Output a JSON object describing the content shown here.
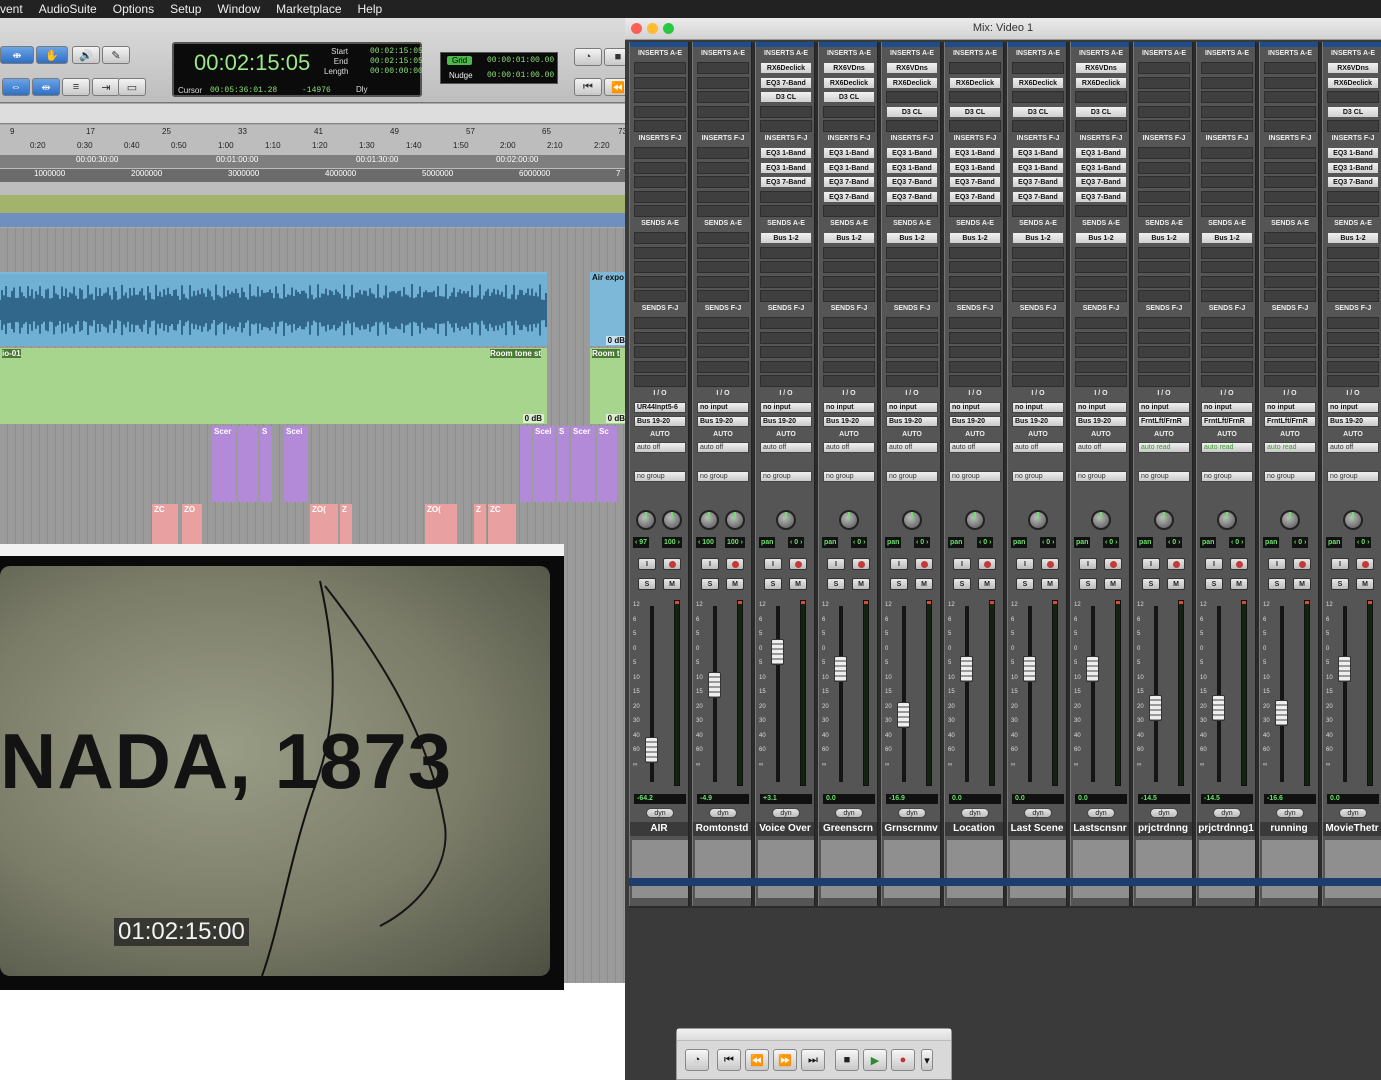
{
  "menubar": {
    "items": [
      "vent",
      "AudioSuite",
      "Options",
      "Setup",
      "Window",
      "Marketplace",
      "Help"
    ]
  },
  "edit": {
    "counter": {
      "main": "00:02:15:05",
      "start_label": "Start",
      "start": "00:02:15:05",
      "end_label": "End",
      "end": "00:02:15:05",
      "length_label": "Length",
      "length": "00:00:00:00",
      "cursor_label": "Cursor",
      "cursor": "00:05:36:01.28",
      "cursor_sample": "-14976",
      "dly_label": "Dly"
    },
    "grid": {
      "grid_label": "Grid",
      "grid_value": "00:00:01:00.00",
      "nudge_label": "Nudge",
      "nudge_value": "00:00:01:00.00"
    },
    "ruler_bars": [
      "9",
      "17",
      "25",
      "33",
      "41",
      "49",
      "57",
      "65",
      "73"
    ],
    "ruler_minsec": [
      "0:20",
      "0:30",
      "0:40",
      "0:50",
      "1:00",
      "1:10",
      "1:20",
      "1:30",
      "1:40",
      "1:50",
      "2:00",
      "2:10",
      "2:20"
    ],
    "ruler_timecode": [
      "00:00:30:00",
      "00:01:00:00",
      "00:01:30:00",
      "00:02:00:00"
    ],
    "ruler_samples": [
      "1000000",
      "2000000",
      "3000000",
      "4000000",
      "5000000",
      "6000000",
      "7"
    ],
    "clips": {
      "air_exp": "Air expo",
      "air_db": "0 dB",
      "io01": "io-01",
      "room_tone_1": "Room tone st",
      "room_tone_2": "Room t",
      "room_db_1": "0 dB",
      "room_db_2": "0 dB",
      "scene_a": "Scer",
      "scene_b": "S",
      "scene_c": "Scei",
      "scene_d": "Scei",
      "scene_e": "S",
      "scene_f": "Scer",
      "scene_g": "Sc",
      "zo_a": "ZC",
      "zo_b": "ZO",
      "zo_c": "ZO(",
      "zo_d": "Z",
      "zo_e": "ZO(",
      "zo_f": "Z",
      "zo_g": "ZC"
    }
  },
  "video": {
    "title_card": "NADA, 1873",
    "timecode": "01:02:15:00"
  },
  "mix": {
    "window_title": "Mix: Video 1",
    "labels": {
      "inserts_ae": "INSERTS A-E",
      "inserts_fj": "INSERTS F-J",
      "sends_ae": "SENDS A-E",
      "sends_fj": "SENDS F-J",
      "io": "I / O",
      "auto": "AUTO",
      "group": "no group",
      "dyn": "dyn",
      "solo": "S",
      "mute": "M",
      "input": "I"
    },
    "strips": [
      {
        "name": "AIR",
        "ins_ae": [],
        "ins_fj": [],
        "send": "",
        "io_in": "UR44Inpt5-6",
        "io_out": "Bus 19-20",
        "auto": "auto off",
        "pan": "‹ 97",
        "pan2": "100 ›",
        "stereo": true,
        "vol": "-64.2",
        "fader": 0.18
      },
      {
        "name": "Romtonstd",
        "ins_ae": [],
        "ins_fj": [],
        "send": "",
        "io_in": "no input",
        "io_out": "Bus 19-20",
        "auto": "auto off",
        "pan": "‹ 100",
        "pan2": "100 ›",
        "stereo": true,
        "vol": "-4.9",
        "fader": 0.55
      },
      {
        "name": "Voice Over",
        "ins_ae": [
          "RX6Declick",
          "EQ3 7-Band",
          "D3 CL"
        ],
        "ins_fj": [
          "EQ3 1-Band",
          "EQ3 1-Band",
          "EQ3 7-Band"
        ],
        "send": "Bus 1-2",
        "io_in": "no input",
        "io_out": "Bus 19-20",
        "auto": "auto off",
        "pan": "pan",
        "pan2": "‹ 0 ›",
        "stereo": false,
        "vol": "+3.1",
        "fader": 0.74
      },
      {
        "name": "Greenscrn",
        "ins_ae": [
          "RX6VDns",
          "RX6Declick",
          "D3 CL"
        ],
        "ins_fj": [
          "EQ3 1-Band",
          "EQ3 1-Band",
          "EQ3 7-Band",
          "EQ3 7-Band"
        ],
        "send": "Bus 1-2",
        "io_in": "no input",
        "io_out": "Bus 19-20",
        "auto": "auto off",
        "pan": "pan",
        "pan2": "‹ 0 ›",
        "stereo": false,
        "vol": "0.0",
        "fader": 0.64
      },
      {
        "name": "Grnscrnmv",
        "ins_ae": [
          "RX6VDns",
          "RX6Declick",
          "",
          "D3 CL"
        ],
        "ins_fj": [
          "EQ3 1-Band",
          "EQ3 1-Band",
          "EQ3 7-Band",
          "EQ3 7-Band"
        ],
        "send": "Bus 1-2",
        "io_in": "no input",
        "io_out": "Bus 19-20",
        "auto": "auto off",
        "pan": "pan",
        "pan2": "‹ 0 ›",
        "stereo": false,
        "vol": "-16.9",
        "fader": 0.38
      },
      {
        "name": "Location",
        "ins_ae": [
          "",
          "RX6Declick",
          "",
          "D3 CL"
        ],
        "ins_fj": [
          "EQ3 1-Band",
          "EQ3 1-Band",
          "EQ3 7-Band",
          "EQ3 7-Band"
        ],
        "send": "Bus 1-2",
        "io_in": "no input",
        "io_out": "Bus 19-20",
        "auto": "auto off",
        "pan": "pan",
        "pan2": "‹ 0 ›",
        "stereo": false,
        "vol": "0.0",
        "fader": 0.64
      },
      {
        "name": "Last Scene",
        "ins_ae": [
          "",
          "RX6Declick",
          "",
          "D3 CL"
        ],
        "ins_fj": [
          "EQ3 1-Band",
          "EQ3 1-Band",
          "EQ3 7-Band",
          "EQ3 7-Band"
        ],
        "send": "Bus 1-2",
        "io_in": "no input",
        "io_out": "Bus 19-20",
        "auto": "auto off",
        "pan": "pan",
        "pan2": "‹ 0 ›",
        "stereo": false,
        "vol": "0.0",
        "fader": 0.64
      },
      {
        "name": "Lastscnsnr",
        "ins_ae": [
          "RX6VDns",
          "RX6Declick",
          "",
          "D3 CL"
        ],
        "ins_fj": [
          "EQ3 1-Band",
          "EQ3 1-Band",
          "EQ3 7-Band",
          "EQ3 7-Band"
        ],
        "send": "Bus 1-2",
        "io_in": "no input",
        "io_out": "Bus 19-20",
        "auto": "auto off",
        "pan": "pan",
        "pan2": "‹ 0 ›",
        "stereo": false,
        "vol": "0.0",
        "fader": 0.64
      },
      {
        "name": "prjctrdnng",
        "ins_ae": [],
        "ins_fj": [],
        "send": "Bus 1-2",
        "io_in": "no input",
        "io_out": "FrntLft/FrnR",
        "auto": "auto read",
        "pan": "pan",
        "pan2": "‹ 0 ›",
        "stereo": false,
        "vol": "-14.5",
        "fader": 0.42
      },
      {
        "name": "prjctrdnng1",
        "ins_ae": [],
        "ins_fj": [],
        "send": "Bus 1-2",
        "io_in": "no input",
        "io_out": "FrntLft/FrnR",
        "auto": "auto read",
        "pan": "pan",
        "pan2": "‹ 0 ›",
        "stereo": false,
        "vol": "-14.5",
        "fader": 0.42
      },
      {
        "name": "running",
        "ins_ae": [],
        "ins_fj": [],
        "send": "",
        "io_in": "no input",
        "io_out": "FrntLft/FrnR",
        "auto": "auto read",
        "pan": "pan",
        "pan2": "‹ 0 ›",
        "stereo": false,
        "vol": "-16.6",
        "fader": 0.39
      },
      {
        "name": "MovieThetr",
        "ins_ae": [
          "RX6VDns",
          "RX6Declick",
          "",
          "D3 CL"
        ],
        "ins_fj": [
          "EQ3 1-Band",
          "EQ3 1-Band",
          "EQ3 7-Band"
        ],
        "send": "Bus 1-2",
        "io_in": "no input",
        "io_out": "Bus 19-20",
        "auto": "auto off",
        "pan": "pan",
        "pan2": "‹ 0 ›",
        "stereo": false,
        "vol": "0.0",
        "fader": 0.64
      }
    ]
  },
  "transport": {
    "buttons": [
      "online-icon",
      "return-to-zero-icon",
      "rewind-icon",
      "fast-forward-icon",
      "go-to-end-icon",
      "stop-icon",
      "play-icon",
      "record-icon"
    ]
  }
}
